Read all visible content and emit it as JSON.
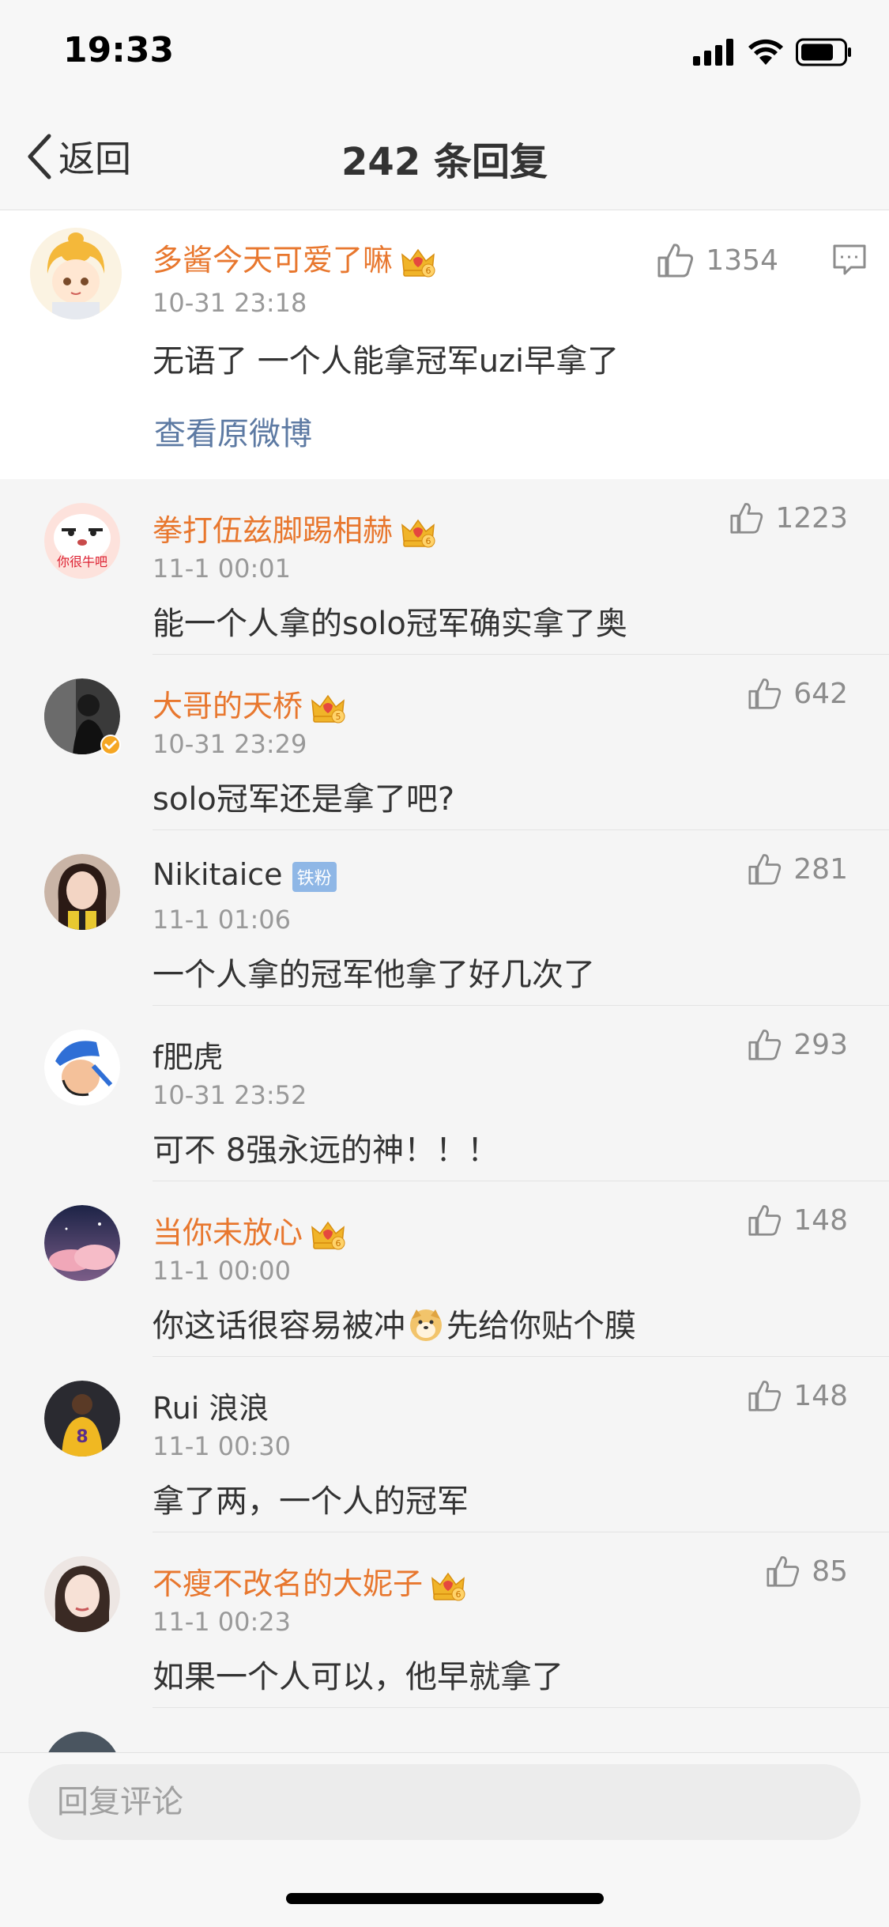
{
  "status_bar": {
    "time": "19:33"
  },
  "nav": {
    "back_label": "返回",
    "title": "242 条回复"
  },
  "main_comment": {
    "username": "多酱今天可爱了嘛",
    "timestamp": "10-31 23:18",
    "text": "无语了 一个人能拿冠军uzi早拿了",
    "likes": "1354",
    "view_original": "查看原微博",
    "crown_level": "6"
  },
  "replies": [
    {
      "username": "拳打伍兹脚踢相赫",
      "name_color": "orange",
      "badge": "crown",
      "badge_level": "6",
      "timestamp": "11-1 00:01",
      "text": "能一个人拿的solo冠军确实拿了奥",
      "likes": "1223",
      "avatar_caption": "你很牛吧"
    },
    {
      "username": "大哥的天桥",
      "name_color": "orange",
      "badge": "crown",
      "badge_level": "5",
      "timestamp": "10-31 23:29",
      "text": "solo冠军还是拿了吧?",
      "likes": "642"
    },
    {
      "username": "Nikitaice",
      "name_color": "dark",
      "badge": "fan",
      "badge_text": "铁粉",
      "timestamp": "11-1 01:06",
      "text": "一个人拿的冠军他拿了好几次了",
      "likes": "281"
    },
    {
      "username": "f肥虎",
      "name_color": "dark",
      "badge": "none",
      "timestamp": "10-31 23:52",
      "text": "可不 8强永远的神！！！",
      "likes": "293"
    },
    {
      "username": "当你未放心",
      "name_color": "orange",
      "badge": "crown",
      "badge_level": "6",
      "timestamp": "11-1 00:00",
      "text_before": "你这话很容易被冲",
      "text_after": "先给你贴个膜",
      "likes": "148"
    },
    {
      "username": "Rui 浪浪",
      "name_color": "dark",
      "badge": "none",
      "timestamp": "11-1 00:30",
      "text": "拿了两，一个人的冠军",
      "likes": "148"
    },
    {
      "username": "不瘦不改名的大妮子",
      "name_color": "orange",
      "badge": "crown",
      "badge_level": "6",
      "timestamp": "11-1 00:23",
      "text": "如果一个人可以，他早就拿了",
      "likes": "85"
    }
  ],
  "reply_input": {
    "placeholder": "回复评论"
  },
  "colors": {
    "orange_name": "#e8772e",
    "link": "#5d7aa3",
    "crown": "#f0b429"
  },
  "icons": [
    "signal-icon",
    "wifi-icon",
    "battery-icon",
    "back-chevron-icon",
    "thumbs-up-icon",
    "comment-icon",
    "crown-icon",
    "verified-icon",
    "dog-emoji-icon"
  ]
}
